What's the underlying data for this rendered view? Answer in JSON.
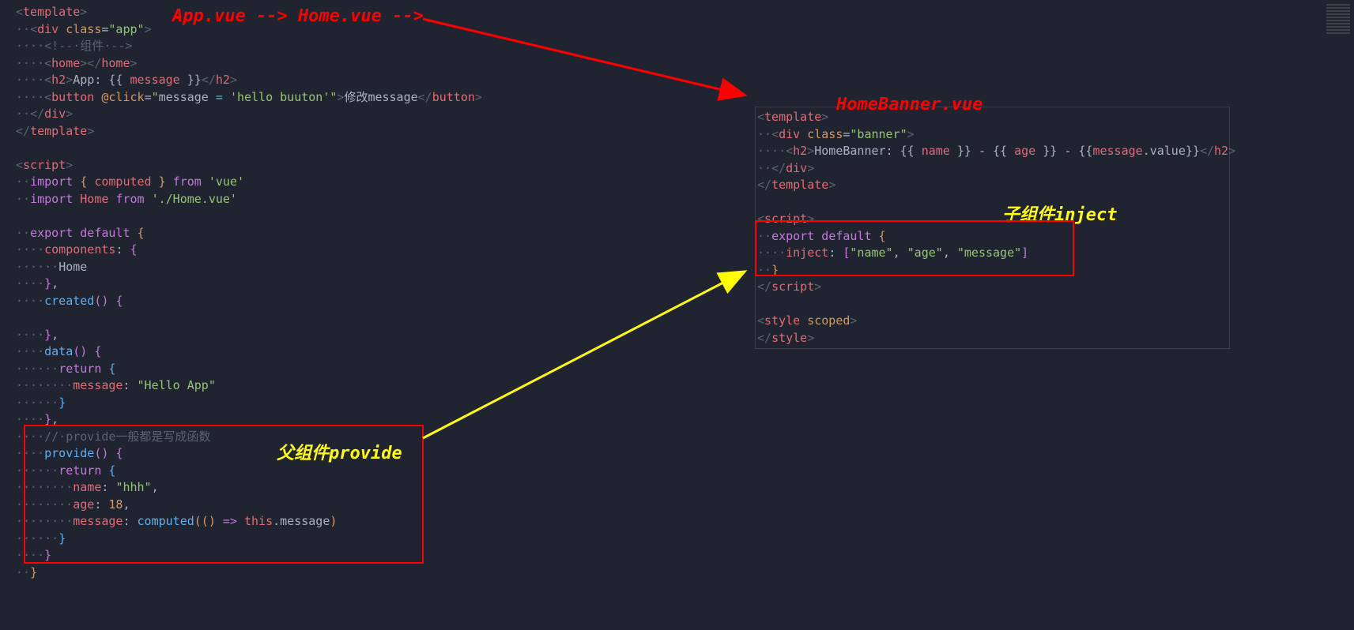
{
  "labels": {
    "top": "App.vue --> Home.vue -->",
    "banner": "HomeBanner.vue",
    "provide": "父组件provide",
    "inject": "子组件inject"
  },
  "left_html": "<span class='t-gray'>&lt;</span><span class='t-red'>template</span><span class='t-gray'>&gt;</span>\n<span class='t-gray'>··</span><span class='t-gray'>&lt;</span><span class='t-red'>div</span> <span class='t-orange'>class</span><span class='t-white'>=</span><span class='t-green'>\"app\"</span><span class='t-gray'>&gt;</span>\n<span class='t-gray'>····</span><span class='t-gray'>&lt;!--·组件·--&gt;</span>\n<span class='t-gray'>····</span><span class='t-gray'>&lt;</span><span class='t-red'>home</span><span class='t-gray'>&gt;&lt;/</span><span class='t-red'>home</span><span class='t-gray'>&gt;</span>\n<span class='t-gray'>····</span><span class='t-gray'>&lt;</span><span class='t-red'>h2</span><span class='t-gray'>&gt;</span><span class='t-white'>App: </span><span class='t-white'>{{ </span><span class='t-red'>message</span><span class='t-white'> }}</span><span class='t-gray'>&lt;/</span><span class='t-red'>h2</span><span class='t-gray'>&gt;</span>\n<span class='t-gray'>····</span><span class='t-gray'>&lt;</span><span class='t-red'>button</span> <span class='t-orange'>@click</span><span class='t-white'>=</span><span class='t-green'>\"</span><span class='t-white'>message </span><span class='t-cyan'>=</span><span class='t-white'> </span><span class='t-green'>'hello buuton'\"</span><span class='t-gray'>&gt;</span><span class='t-white'>修改message</span><span class='t-gray'>&lt;/</span><span class='t-red'>button</span><span class='t-gray'>&gt;</span>\n<span class='t-gray'>··</span><span class='t-gray'>&lt;/</span><span class='t-red'>div</span><span class='t-gray'>&gt;</span>\n<span class='t-gray'>&lt;/</span><span class='t-red'>template</span><span class='t-gray'>&gt;</span>\n\n<span class='t-gray'>&lt;</span><span class='t-red'>script</span><span class='t-gray'>&gt;</span>\n<span class='t-gray'>··</span><span class='t-purple'>import</span><span class='t-white'> </span><span class='t-orange'>{</span><span class='t-white'> </span><span class='t-red'>computed</span><span class='t-white'> </span><span class='t-orange'>}</span><span class='t-white'> </span><span class='t-purple'>from</span><span class='t-white'> </span><span class='t-green'>'vue'</span>\n<span class='t-gray'>··</span><span class='t-purple'>import</span><span class='t-white'> </span><span class='t-red'>Home</span><span class='t-white'> </span><span class='t-purple'>from</span><span class='t-white'> </span><span class='t-green'>'./Home.vue'</span>\n\n<span class='t-gray'>··</span><span class='t-purple'>export</span><span class='t-white'> </span><span class='t-purple'>default</span><span class='t-white'> </span><span class='t-orange'>{</span>\n<span class='t-gray'>····</span><span class='t-red'>components</span><span class='t-white'>: </span><span class='t-purple'>{</span>\n<span class='t-gray'>······</span><span class='t-white'>Home</span>\n<span class='t-gray'>····</span><span class='t-purple'>}</span><span class='t-white'>,</span>\n<span class='t-gray'>····</span><span class='t-blue'>created</span><span class='t-purple'>()</span><span class='t-white'> </span><span class='t-purple'>{</span>\n\n<span class='t-gray'>····</span><span class='t-purple'>}</span><span class='t-white'>,</span>\n<span class='t-gray'>····</span><span class='t-blue'>data</span><span class='t-purple'>()</span><span class='t-white'> </span><span class='t-purple'>{</span>\n<span class='t-gray'>······</span><span class='t-purple'>return</span><span class='t-white'> </span><span class='t-blue'>{</span>\n<span class='t-gray'>········</span><span class='t-red'>message</span><span class='t-white'>: </span><span class='t-green'>\"Hello App\"</span>\n<span class='t-gray'>······</span><span class='t-blue'>}</span>\n<span class='t-gray'>····</span><span class='t-purple'>}</span><span class='t-white'>,</span>\n<span class='t-gray'>····</span><span class='t-gray'>//·provide一般都是写成函数</span>\n<span class='t-gray'>····</span><span class='t-blue'>provide</span><span class='t-purple'>()</span><span class='t-white'> </span><span class='t-purple'>{</span>\n<span class='t-gray'>······</span><span class='t-purple'>return</span><span class='t-white'> </span><span class='t-blue'>{</span>\n<span class='t-gray'>········</span><span class='t-red'>name</span><span class='t-white'>: </span><span class='t-green'>\"hhh\"</span><span class='t-white'>,</span>\n<span class='t-gray'>········</span><span class='t-red'>age</span><span class='t-white'>: </span><span class='t-orange'>18</span><span class='t-white'>,</span>\n<span class='t-gray'>········</span><span class='t-red'>message</span><span class='t-white'>: </span><span class='t-blue'>computed</span><span class='t-orange'>(()</span><span class='t-white'> </span><span class='t-purple'>=&gt;</span><span class='t-white'> </span><span class='t-red'>this</span><span class='t-white'>.message</span><span class='t-orange'>)</span>\n<span class='t-gray'>······</span><span class='t-blue'>}</span>\n<span class='t-gray'>····</span><span class='t-purple'>}</span>\n<span class='t-gray'>··</span><span class='t-orange'>}</span>",
  "right_html": "<span class='t-gray'>&lt;</span><span class='t-red'>template</span><span class='t-gray'>&gt;</span>\n<span class='t-gray'>··</span><span class='t-gray'>&lt;</span><span class='t-red'>div</span> <span class='t-orange'>class</span><span class='t-white'>=</span><span class='t-green'>\"banner\"</span><span class='t-gray'>&gt;</span>\n<span class='t-gray'>····</span><span class='t-gray'>&lt;</span><span class='t-red'>h2</span><span class='t-gray'>&gt;</span><span class='t-white'>HomeBanner: {{ </span><span class='t-red'>name</span><span class='t-white'> }} - {{ </span><span class='t-red'>age</span><span class='t-white'> }} - {{</span><span class='t-red'>message</span><span class='t-white'>.value}}</span><span class='t-gray'>&lt;/</span><span class='t-red'>h2</span><span class='t-gray'>&gt;</span>\n<span class='t-gray'>··</span><span class='t-gray'>&lt;/</span><span class='t-red'>div</span><span class='t-gray'>&gt;</span>\n<span class='t-gray'>&lt;/</span><span class='t-red'>template</span><span class='t-gray'>&gt;</span>\n\n<span class='t-gray'>&lt;</span><span class='t-red'>script</span><span class='t-gray'>&gt;</span>\n<span class='t-gray'>··</span><span class='t-purple'>export</span><span class='t-white'> </span><span class='t-purple'>default</span><span class='t-white'> </span><span class='t-orange'>{</span>\n<span class='t-gray'>····</span><span class='t-red'>inject</span><span class='t-white'>: </span><span class='t-purple'>[</span><span class='t-green'>\"name\"</span><span class='t-white'>, </span><span class='t-green'>\"age\"</span><span class='t-white'>, </span><span class='t-green'>\"message\"</span><span class='t-purple'>]</span>\n<span class='t-gray'>··</span><span class='t-orange'>}</span>\n<span class='t-gray'>&lt;/</span><span class='t-red'>script</span><span class='t-gray'>&gt;</span>\n\n<span class='t-gray'>&lt;</span><span class='t-red'>style</span> <span class='t-orange'>scoped</span><span class='t-gray'>&gt;</span>\n<span class='t-gray'>&lt;/</span><span class='t-red'>style</span><span class='t-gray'>&gt;</span>"
}
